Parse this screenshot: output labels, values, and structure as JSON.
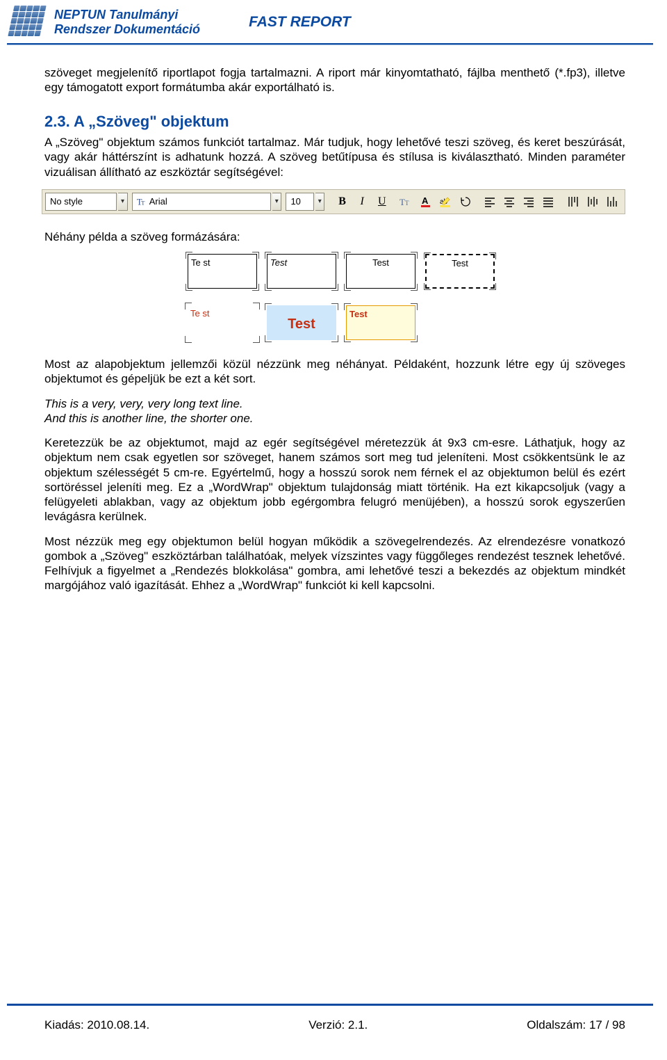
{
  "header": {
    "line1": "NEPTUN Tanulmányi",
    "line2": "Rendszer Dokumentáció",
    "fast": "FAST REPORT"
  },
  "body": {
    "p1": "szöveget megjelenítő riportlapot fogja tartalmazni. A riport már kinyomtatható, fájlba menthető (*.fp3), illetve egy támogatott export formátumba akár exportálható is.",
    "h2": "2.3. A „Szöveg\" objektum",
    "p2": "A „Szöveg\" objektum számos funkciót tartalmaz. Már tudjuk, hogy lehetővé teszi szöveg, és keret beszúrását, vagy akár háttérszínt is adhatunk hozzá. A szöveg betűtípusa és stílusa is kiválasztható. Minden paraméter vizuálisan állítható az eszköztár segítségével:",
    "p3": "Néhány példa a szöveg formázására:",
    "p4": "Most az alapobjektum jellemzői közül nézzünk meg néhányat. Példaként, hozzunk létre egy új szöveges objektumot és gépeljük be ezt a két sort.",
    "it1": "This is a very, very, very long text line.",
    "it2": "And this is another line, the shorter one.",
    "p5": "Keretezzük be az objektumot, majd az egér segítségével méretezzük át 9x3 cm-esre. Láthatjuk, hogy az objektum nem csak egyetlen sor szöveget, hanem számos sort meg tud jeleníteni. Most csökkentsünk le az objektum szélességét 5 cm-re. Egyértelmű, hogy a hosszú sorok nem férnek el az objektumon belül és ezért sortöréssel jeleníti meg. Ez a „WordWrap\" objektum tulajdonság miatt történik. Ha ezt kikapcsoljuk (vagy a felügyeleti ablakban, vagy az objektum jobb egérgombra felugró menüjében), a hosszú sorok egyszerűen levágásra kerülnek.",
    "p6": "Most nézzük meg egy objektumon belül hogyan működik a szövegelrendezés. Az elrendezésre vonatkozó gombok a „Szöveg\" eszköztárban találhatóak, melyek vízszintes vagy függőleges rendezést tesznek lehetővé. Felhívjuk a figyelmet a „Rendezés blokkolása\" gombra, ami lehetővé teszi a bekezdés az objektum mindkét margójához való igazítását. Ehhez a „WordWrap\" funkciót ki kell kapcsolni."
  },
  "toolbar": {
    "style": "No style",
    "font": "Arial",
    "size": "10"
  },
  "examples": {
    "e1": "Te st",
    "e2": "Test",
    "e3": "Test",
    "e4": "Test",
    "e5": "Te st",
    "e6": "Test",
    "e7": "Test"
  },
  "footer": {
    "left": "Kiadás: 2010.08.14.",
    "center": "Verzió: 2.1.",
    "right": "Oldalszám: 17 / 98"
  }
}
